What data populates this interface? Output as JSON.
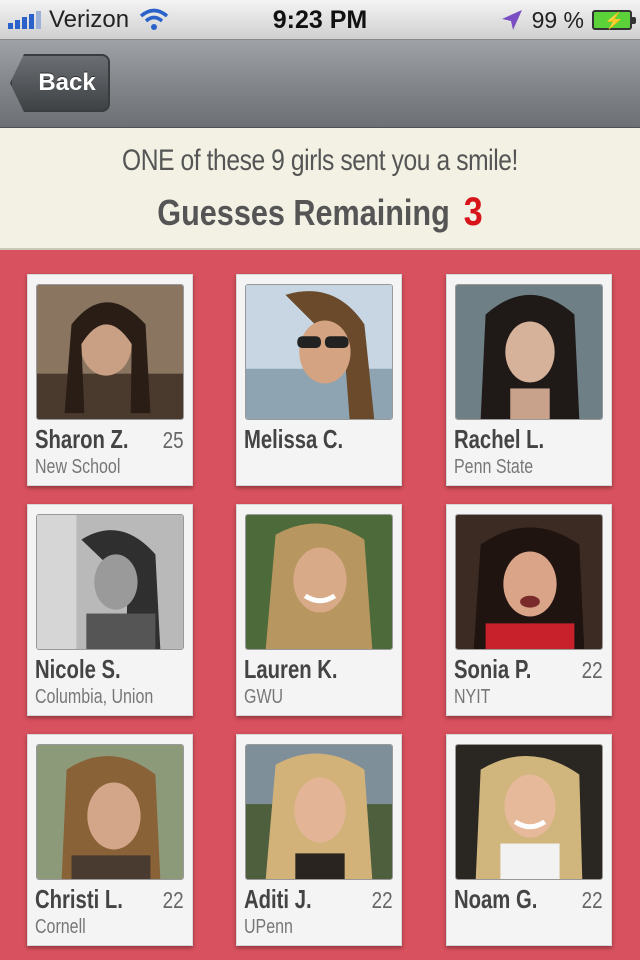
{
  "status_bar": {
    "carrier": "Verizon",
    "time": "9:23 PM",
    "battery": "99 %"
  },
  "nav": {
    "back_label": "Back"
  },
  "header": {
    "subtitle": "ONE of these 9 girls sent you a smile!",
    "guesses_label": "Guesses Remaining",
    "guesses_count": "3"
  },
  "profiles": [
    {
      "name": "Sharon Z.",
      "age": "25",
      "school": "New School"
    },
    {
      "name": "Melissa C.",
      "age": "",
      "school": ""
    },
    {
      "name": "Rachel L.",
      "age": "",
      "school": "Penn State"
    },
    {
      "name": "Nicole S.",
      "age": "",
      "school": "Columbia, Union"
    },
    {
      "name": "Lauren K.",
      "age": "",
      "school": "GWU"
    },
    {
      "name": "Sonia P.",
      "age": "22",
      "school": "NYIT"
    },
    {
      "name": "Christi L.",
      "age": "22",
      "school": "Cornell"
    },
    {
      "name": "Aditi J.",
      "age": "22",
      "school": "UPenn"
    },
    {
      "name": "Noam G.",
      "age": "22",
      "school": ""
    }
  ],
  "colors": {
    "background": "#d8515e",
    "header_bg": "#f2f1e4",
    "guesses_count": "#d8141b"
  }
}
